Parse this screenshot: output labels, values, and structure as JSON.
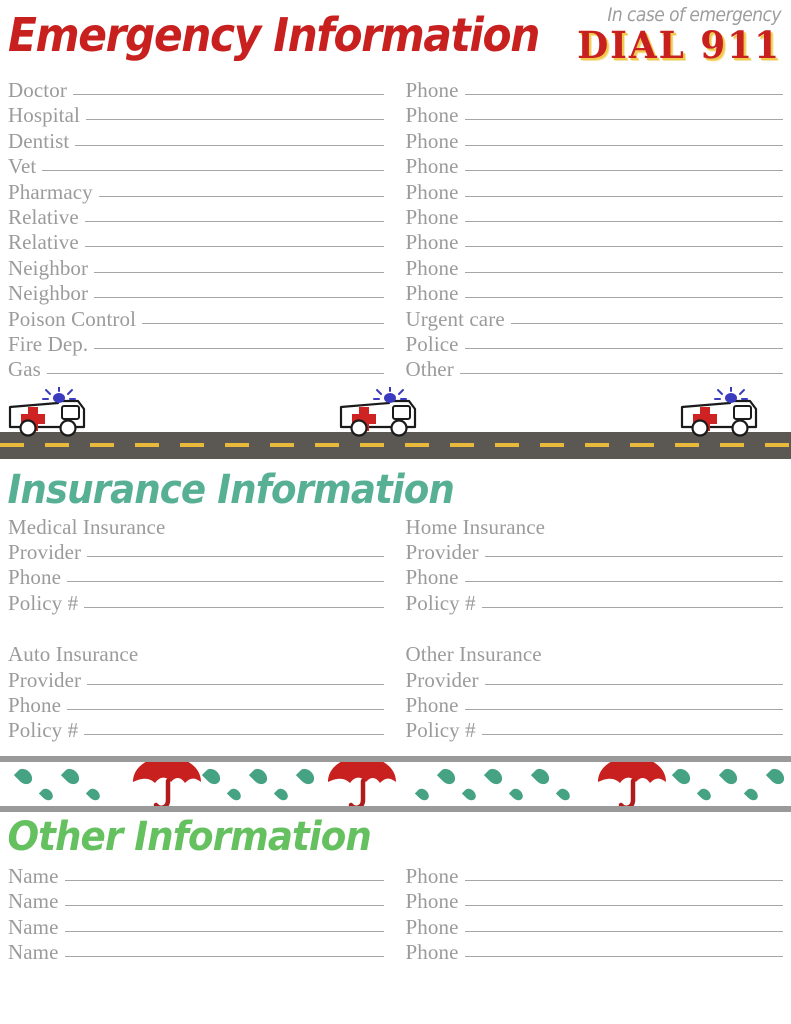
{
  "header": {
    "title": "Emergency Information",
    "badge_sub": "In case of emergency",
    "badge_main": "DIAL 911"
  },
  "emergency": {
    "left_rows": [
      {
        "label": "Doctor"
      },
      {
        "label": "Hospital"
      },
      {
        "label": "Dentist"
      },
      {
        "label": "Vet"
      },
      {
        "label": "Pharmacy"
      },
      {
        "label": "Relative"
      },
      {
        "label": "Relative"
      },
      {
        "label": "Neighbor"
      },
      {
        "label": "Neighbor"
      },
      {
        "label": "Poison Control"
      },
      {
        "label": "Fire Dep."
      },
      {
        "label": "Gas"
      }
    ],
    "right_rows": [
      {
        "label": "Phone"
      },
      {
        "label": "Phone"
      },
      {
        "label": "Phone"
      },
      {
        "label": "Phone"
      },
      {
        "label": "Phone"
      },
      {
        "label": "Phone"
      },
      {
        "label": "Phone"
      },
      {
        "label": "Phone"
      },
      {
        "label": "Phone"
      },
      {
        "label": "Urgent care"
      },
      {
        "label": "Police"
      },
      {
        "label": "Other"
      }
    ]
  },
  "insurance": {
    "heading": "Insurance Information",
    "blocks": [
      {
        "title": "Medical Insurance",
        "fields": [
          {
            "label": "Provider"
          },
          {
            "label": "Phone"
          },
          {
            "label": "Policy #"
          }
        ]
      },
      {
        "title": "Home Insurance",
        "fields": [
          {
            "label": "Provider"
          },
          {
            "label": "Phone"
          },
          {
            "label": "Policy #"
          }
        ]
      },
      {
        "title": "Auto Insurance",
        "fields": [
          {
            "label": "Provider"
          },
          {
            "label": "Phone"
          },
          {
            "label": "Policy #"
          }
        ]
      },
      {
        "title": "Other Insurance",
        "fields": [
          {
            "label": "Provider"
          },
          {
            "label": "Phone"
          },
          {
            "label": "Policy #"
          }
        ]
      }
    ]
  },
  "other": {
    "heading": "Other Information",
    "left_rows": [
      {
        "label": "Name"
      },
      {
        "label": "Name"
      },
      {
        "label": "Name"
      },
      {
        "label": "Name"
      }
    ],
    "right_rows": [
      {
        "label": "Phone"
      },
      {
        "label": "Phone"
      },
      {
        "label": "Phone"
      },
      {
        "label": "Phone"
      }
    ]
  },
  "colors": {
    "title_red": "#c8201f",
    "badge_shadow": "#f0c94a",
    "insurance_teal": "#57b093",
    "other_green": "#65c05f",
    "label_gray": "#9b9b9b",
    "line_gray": "#a6a6a6",
    "road_gray": "#5b5753",
    "road_dash_yellow": "#e8b93b",
    "drop_green": "#45a283",
    "umbrella_red": "#c8201f",
    "rule_gray": "#9a9a9a"
  },
  "decor": {
    "ambulance_icon": "ambulance-icon",
    "siren_icon": "siren-light-icon",
    "red_cross_icon": "red-cross-icon",
    "umbrella_icon": "umbrella-icon",
    "raindrop_icon": "raindrop-icon"
  }
}
